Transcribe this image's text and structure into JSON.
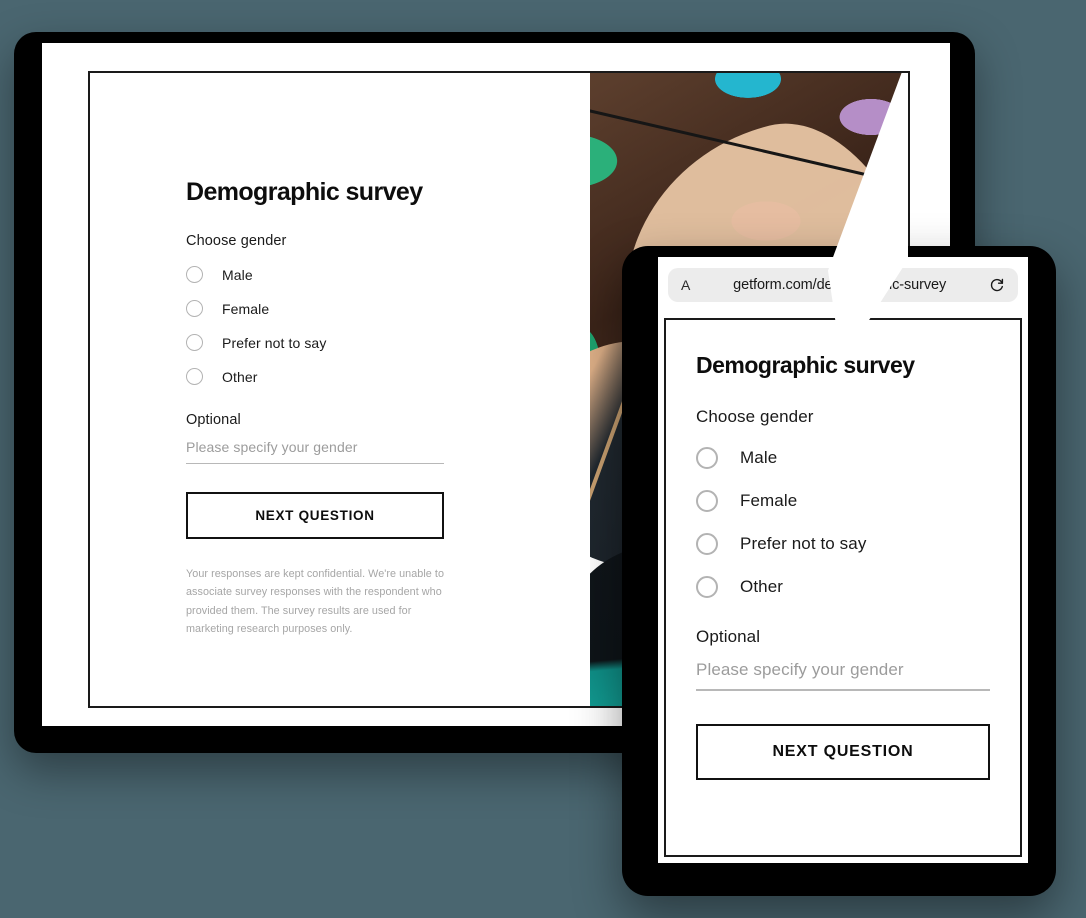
{
  "theme": {
    "background_color": "#4a6670",
    "device_frame_color": "#000000",
    "text_color": "#1a1a1a",
    "muted_text_color": "#a6a6a6",
    "radio_border_color": "#b3b3b3",
    "button_border_color": "#111111",
    "urlbar_background": "#ececec"
  },
  "desktop": {
    "form": {
      "title": "Demographic survey",
      "question_label": "Choose gender",
      "options": [
        {
          "label": "Male"
        },
        {
          "label": "Female"
        },
        {
          "label": "Prefer not to say"
        },
        {
          "label": "Other"
        }
      ],
      "optional_label": "Optional",
      "input_placeholder": "Please specify your gender",
      "input_value": "",
      "submit_label": "NEXT QUESTION",
      "disclaimer": "Your responses are kept confidential. We're unable to associate survey responses with the respondent who provided them. The survey results are used for marketing research purposes only."
    },
    "media": {
      "description": "Photograph of two smiling women wearing sunglasses in front of a colorful street mural, masked into overlapping circular shapes"
    }
  },
  "mobile": {
    "browser": {
      "text_size_icon": "aa-text-size-icon",
      "text_size_label": "A",
      "url": "getform.com/demographic-survey",
      "reload_icon": "reload-icon"
    },
    "form": {
      "title": "Demographic survey",
      "question_label": "Choose gender",
      "options": [
        {
          "label": "Male"
        },
        {
          "label": "Female"
        },
        {
          "label": "Prefer not to say"
        },
        {
          "label": "Other"
        }
      ],
      "optional_label": "Optional",
      "input_placeholder": "Please specify your gender",
      "input_value": "",
      "submit_label": "NEXT QUESTION"
    }
  }
}
